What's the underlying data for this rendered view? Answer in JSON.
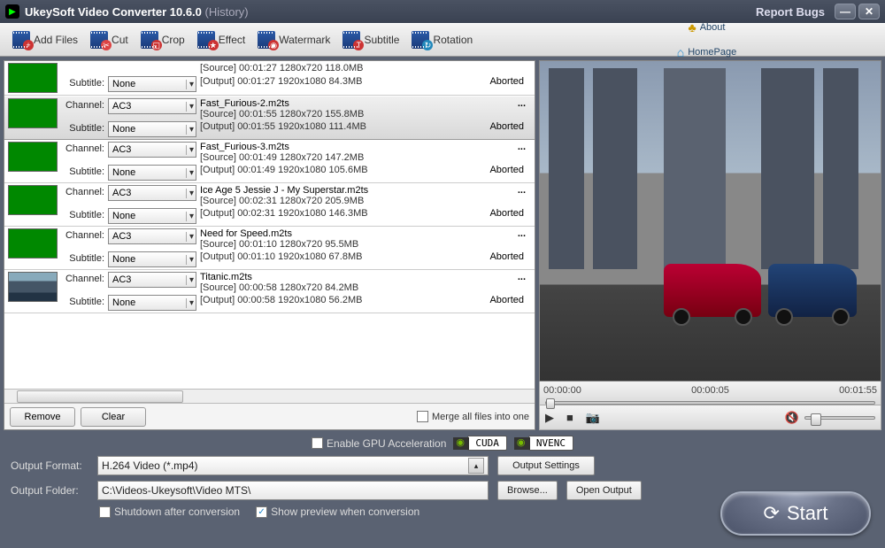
{
  "title": {
    "app": "UkeySoft Video Converter 10.6.0",
    "history": "(History)"
  },
  "winbtns": {
    "bugs": "Report Bugs"
  },
  "toolbar": {
    "add": "Add Files",
    "cut": "Cut",
    "crop": "Crop",
    "effect": "Effect",
    "watermark": "Watermark",
    "subtitle": "Subtitle",
    "rotation": "Rotation",
    "about": "About",
    "homepage": "HomePage"
  },
  "labels": {
    "channel": "Channel:",
    "subtitle": "Subtitle:"
  },
  "files": [
    {
      "ch": "",
      "sub": "None",
      "title": "",
      "src": "[Source]  00:01:27  1280x720  118.0MB",
      "out": "[Output]  00:01:27  1920x1080  84.3MB",
      "status": "Aborted",
      "dots": ""
    },
    {
      "ch": "AC3",
      "sub": "None",
      "title": "Fast_Furious-2.m2ts",
      "src": "[Source]  00:01:55  1280x720  155.8MB",
      "out": "[Output]  00:01:55  1920x1080  111.4MB",
      "status": "Aborted",
      "dots": "..."
    },
    {
      "ch": "AC3",
      "sub": "None",
      "title": "Fast_Furious-3.m2ts",
      "src": "[Source]  00:01:49  1280x720  147.2MB",
      "out": "[Output]  00:01:49  1920x1080  105.6MB",
      "status": "Aborted",
      "dots": "..."
    },
    {
      "ch": "AC3",
      "sub": "None",
      "title": "Ice Age 5  Jessie J - My Superstar.m2ts",
      "src": "[Source]  00:02:31  1280x720  205.9MB",
      "out": "[Output]  00:02:31  1920x1080  146.3MB",
      "status": "Aborted",
      "dots": "..."
    },
    {
      "ch": "AC3",
      "sub": "None",
      "title": "Need for Speed.m2ts",
      "src": "[Source]  00:01:10  1280x720  95.5MB",
      "out": "[Output]  00:01:10  1920x1080  67.8MB",
      "status": "Aborted",
      "dots": "..."
    },
    {
      "ch": "AC3",
      "sub": "None",
      "title": "Titanic.m2ts",
      "src": "[Source]  00:00:58  1280x720  84.2MB",
      "out": "[Output]  00:00:58  1920x1080  56.2MB",
      "status": "Aborted",
      "dots": "..."
    }
  ],
  "leftbot": {
    "remove": "Remove",
    "clear": "Clear",
    "merge": "Merge all files into one"
  },
  "preview": {
    "t0": "00:00:00",
    "t1": "00:00:05",
    "t2": "00:01:55"
  },
  "gpu": {
    "enable": "Enable GPU Acceleration",
    "cuda": "CUDA",
    "nvenc": "NVENC"
  },
  "out": {
    "format_label": "Output Format:",
    "format_value": "H.264 Video (*.mp4)",
    "folder_label": "Output Folder:",
    "folder_value": "C:\\Videos-Ukeysoft\\Video MTS\\",
    "settings": "Output Settings",
    "browse": "Browse...",
    "open": "Open Output"
  },
  "checks": {
    "shutdown": "Shutdown after conversion",
    "preview": "Show preview when conversion"
  },
  "start": "Start"
}
